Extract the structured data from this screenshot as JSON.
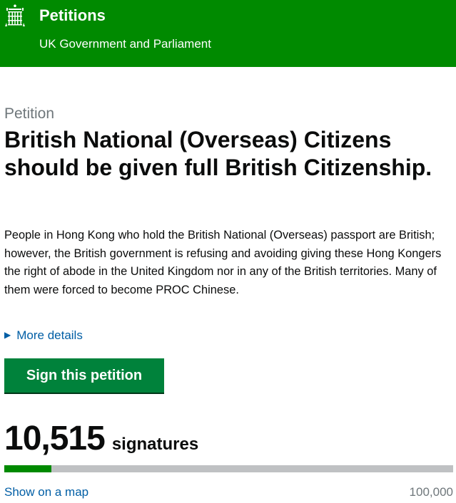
{
  "header": {
    "site_title": "Petitions",
    "site_subtitle": "UK Government and Parliament",
    "logo_icon": "portcullis-icon"
  },
  "petition": {
    "kicker": "Petition",
    "title": "British National (Overseas) Citizens should be given full British Citizenship.",
    "description": "People in Hong Kong who hold the British National (Overseas) passport are British; however, the British government is refusing and avoiding giving these Hong Kongers the right of abode in the United Kingdom nor in any of the British territories. Many of them were forced to become PROC Chinese.",
    "more_details_label": "More details",
    "sign_button_label": "Sign this petition"
  },
  "signatures": {
    "count": "10,515",
    "label": "signatures",
    "target": "100,000",
    "progress_fraction": 0.105,
    "map_link_label": "Show on a map"
  },
  "colors": {
    "header_green": "#008a00",
    "button_green": "#00823b",
    "link_blue": "#005ea5",
    "progress_track": "#bfc1c3"
  }
}
